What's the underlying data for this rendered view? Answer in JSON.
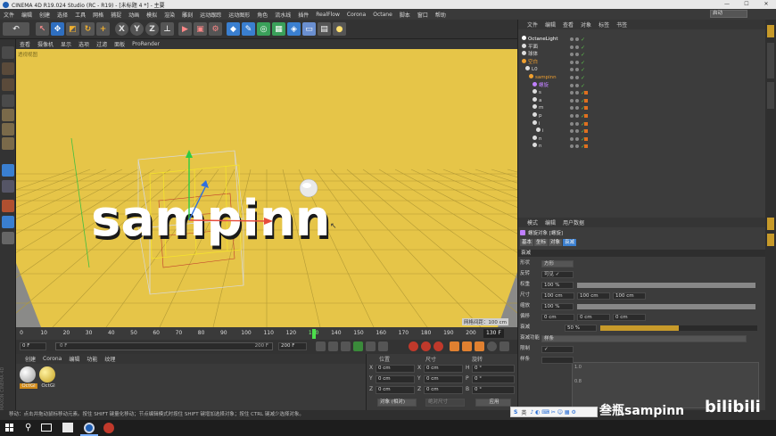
{
  "window": {
    "title": "CINEMA 4D R19.024 Studio (RC - R19) - [未标题 4 *] - 主要",
    "controls": [
      "—",
      "☐",
      "✕"
    ]
  },
  "menu": {
    "items": [
      "文件",
      "编辑",
      "创建",
      "选择",
      "工具",
      "网格",
      "捕捉",
      "动画",
      "模拟",
      "渲染",
      "雕刻",
      "运动跟踪",
      "运动图形",
      "角色",
      "流水线",
      "插件",
      "RealFlow",
      "Corona",
      "Octane",
      "脚本",
      "窗口",
      "帮助"
    ],
    "layout_label": "界面:",
    "layout_value": "启动"
  },
  "viewport": {
    "tabs": [
      "查看",
      "摄像机",
      "显示",
      "选项",
      "过滤",
      "面板",
      "ProRender"
    ],
    "label": "透视视图",
    "text3d": "sampinn",
    "grid_spacing": "网格间距：100 cm",
    "colors": {
      "background": "#e6c548",
      "grid": "#b39a35",
      "floor": "#e2be3c"
    }
  },
  "timeline": {
    "ticks": [
      "0",
      "10",
      "20",
      "30",
      "40",
      "50",
      "60",
      "70",
      "80",
      "90",
      "100",
      "110",
      "120",
      "130",
      "140",
      "150",
      "160",
      "170",
      "180",
      "190",
      "200"
    ],
    "current_frame": "130",
    "end_label": "130 F",
    "playhead_frame": 130
  },
  "transport": {
    "start": "0 F",
    "range_start": "0 F",
    "range_end": "200 F",
    "end": "200 F"
  },
  "materials": {
    "tabs": [
      "创建",
      "Corona",
      "编辑",
      "功能",
      "纹理"
    ],
    "items": [
      {
        "name": "OctGl"
      },
      {
        "name": "OctGl"
      }
    ],
    "watermark": "MAXON CINEMA 4D"
  },
  "coords": {
    "headers": [
      "位置",
      "尺寸",
      "旋转"
    ],
    "rows": [
      {
        "axis": "X",
        "pos": "0 cm",
        "size_axis": "X",
        "size": "0 cm",
        "rot_axis": "H",
        "rot": "0 °"
      },
      {
        "axis": "Y",
        "pos": "0 cm",
        "size_axis": "Y",
        "size": "0 cm",
        "rot_axis": "P",
        "rot": "0 °"
      },
      {
        "axis": "Z",
        "pos": "0 cm",
        "size_axis": "Z",
        "size": "0 cm",
        "rot_axis": "B",
        "rot": "0 °"
      }
    ],
    "mode": "对象 (相对)",
    "mode2": "绝对尺寸",
    "apply": "应用"
  },
  "object_manager": {
    "tabs": [
      "文件",
      "编辑",
      "查看",
      "对象",
      "标签",
      "书签"
    ],
    "rows": [
      {
        "indent": 0,
        "name": "OctaneLight",
        "color": "#ffffff"
      },
      {
        "indent": 0,
        "name": "平面",
        "color": "#dddddd"
      },
      {
        "indent": 0,
        "name": "球体",
        "color": "#dddddd"
      },
      {
        "indent": 0,
        "name": "空白",
        "color": "#f0a030"
      },
      {
        "indent": 1,
        "name": "L0",
        "color": "#dddddd"
      },
      {
        "indent": 2,
        "name": "sampinn",
        "color": "#f0a030"
      },
      {
        "indent": 3,
        "name": "螺旋",
        "color": "#c080ff"
      },
      {
        "indent": 3,
        "name": "s",
        "color": "#dddddd"
      },
      {
        "indent": 3,
        "name": "a",
        "color": "#dddddd"
      },
      {
        "indent": 3,
        "name": "m",
        "color": "#dddddd"
      },
      {
        "indent": 3,
        "name": "p",
        "color": "#dddddd"
      },
      {
        "indent": 3,
        "name": "i",
        "color": "#dddddd"
      },
      {
        "indent": 4,
        "name": "i",
        "color": "#dddddd"
      },
      {
        "indent": 3,
        "name": "n",
        "color": "#dddddd"
      },
      {
        "indent": 3,
        "name": "n",
        "color": "#dddddd"
      }
    ]
  },
  "attributes": {
    "tabs": [
      "模式",
      "编辑",
      "用户数据"
    ],
    "object_title": "螺旋对象 [螺旋]",
    "subtabs": [
      "基本",
      "坐标",
      "对象",
      "衰减"
    ],
    "section": "衰减",
    "rows": [
      {
        "label": "形状",
        "value": "方形"
      },
      {
        "label": "反转",
        "value": "可见 ✓"
      },
      {
        "label": "权重",
        "value": "100 %"
      },
      {
        "label": "尺寸",
        "v1": "100 cm",
        "v2": "100 cm",
        "v3": "100 cm"
      },
      {
        "label": "缩放",
        "value": "100 %"
      },
      {
        "label": "偏移",
        "v1": "0 cm",
        "v2": "0 cm",
        "v3": "0 cm"
      },
      {
        "label": "衰减",
        "value": "50 %"
      },
      {
        "label": "衰减功能",
        "value": "样条"
      },
      {
        "label": "限制",
        "value": "✓"
      },
      {
        "label": "样条",
        "value": ""
      }
    ],
    "graph_labels": [
      "1.0",
      "0.8"
    ],
    "weight_fill": 1.0,
    "falloff_fill": 0.5
  },
  "status": {
    "text": "移动：点击并拖动鼠标移动元素。按住 SHIFT 键量化移动；节点编辑模式时按住 SHIFT 键增加选择对象；按住 CTRL 键减少选择对象。"
  },
  "overlay": {
    "ime": "英",
    "channel": "叁瓶sampinn",
    "logo": "bilibili"
  },
  "taskbar": {
    "time": "",
    "search_icon": "search-icon"
  }
}
